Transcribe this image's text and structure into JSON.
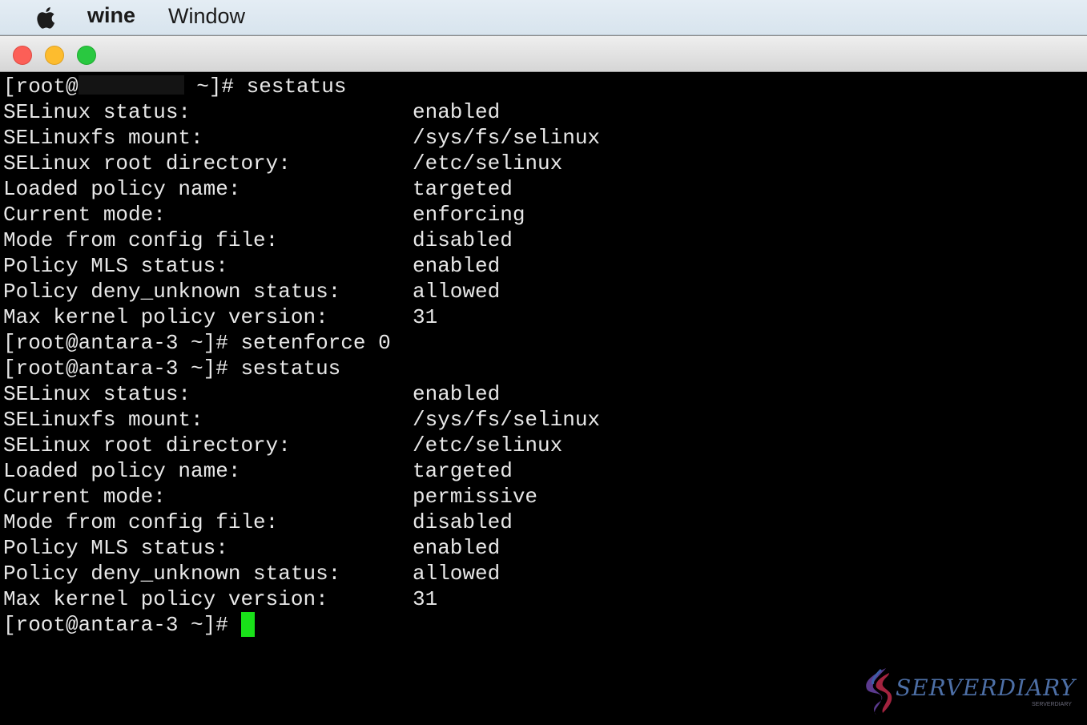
{
  "menubar": {
    "app_name": "wine",
    "menu_window": "Window",
    "apple_icon": "apple-logo-icon"
  },
  "window": {
    "controls": [
      "close",
      "minimize",
      "zoom"
    ],
    "colors": {
      "close": "#fc5f57",
      "minimize": "#fdbc2e",
      "zoom": "#29c840"
    }
  },
  "terminal": {
    "colors": {
      "background": "#000000",
      "text": "#e8e8e8",
      "cursor": "#19e119"
    },
    "first_prompt": {
      "prefix": "[root@",
      "suffix": " ~]# ",
      "command": "sestatus"
    },
    "status1": [
      {
        "label": "SELinux status:",
        "value": "enabled"
      },
      {
        "label": "SELinuxfs mount:",
        "value": "/sys/fs/selinux"
      },
      {
        "label": "SELinux root directory:",
        "value": "/etc/selinux"
      },
      {
        "label": "Loaded policy name:",
        "value": "targeted"
      },
      {
        "label": "Current mode:",
        "value": "enforcing"
      },
      {
        "label": "Mode from config file:",
        "value": "disabled"
      },
      {
        "label": "Policy MLS status:",
        "value": "enabled"
      },
      {
        "label": "Policy deny_unknown status:",
        "value": "allowed"
      },
      {
        "label": "Max kernel policy version:",
        "value": "31"
      }
    ],
    "prompt_setenforce": "[root@antara-3 ~]# setenforce 0",
    "prompt_sestatus": "[root@antara-3 ~]# sestatus",
    "status2": [
      {
        "label": "SELinux status:",
        "value": "enabled"
      },
      {
        "label": "SELinuxfs mount:",
        "value": "/sys/fs/selinux"
      },
      {
        "label": "SELinux root directory:",
        "value": "/etc/selinux"
      },
      {
        "label": "Loaded policy name:",
        "value": "targeted"
      },
      {
        "label": "Current mode:",
        "value": "permissive"
      },
      {
        "label": "Mode from config file:",
        "value": "disabled"
      },
      {
        "label": "Policy MLS status:",
        "value": "enabled"
      },
      {
        "label": "Policy deny_unknown status:",
        "value": "allowed"
      },
      {
        "label": "Max kernel policy version:",
        "value": "31"
      }
    ],
    "final_prompt": "[root@antara-3 ~]# "
  },
  "watermark": {
    "text": "SERVERDIARY",
    "small_text": "SERVERDIARY"
  }
}
